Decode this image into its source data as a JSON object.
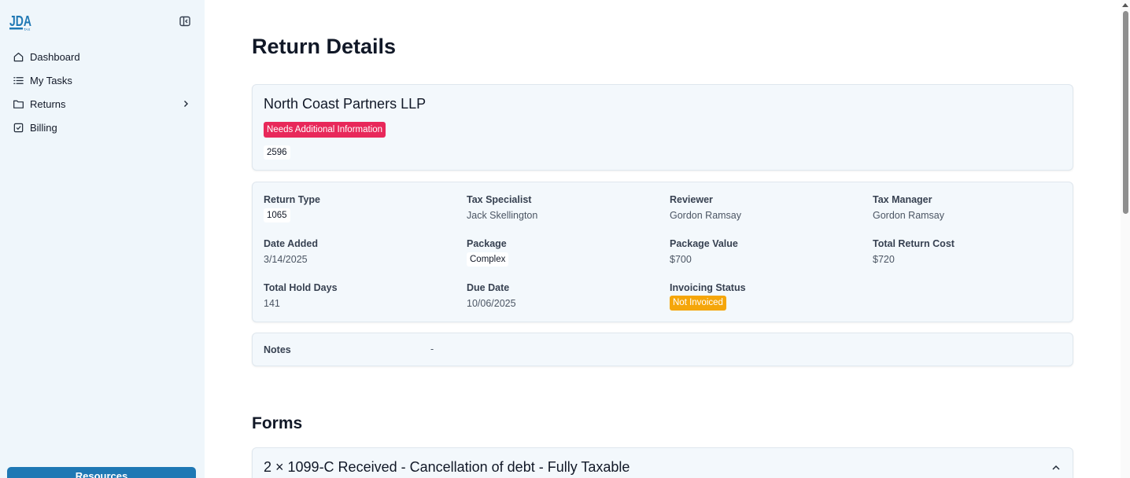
{
  "sidebar": {
    "logo": {
      "main": "JDA",
      "sub": "TAX",
      "icon": "jda-logo"
    },
    "collapse_icon": "sidebar-collapse-icon",
    "items": [
      {
        "label": "Dashboard",
        "icon": "home-icon"
      },
      {
        "label": "My Tasks",
        "icon": "list-icon"
      },
      {
        "label": "Returns",
        "icon": "folder-icon",
        "has_submenu": true
      },
      {
        "label": "Billing",
        "icon": "clipboard-check-icon"
      }
    ],
    "resources_label": "Resources"
  },
  "page": {
    "title": "Return Details"
  },
  "client": {
    "name": "North Coast Partners LLP",
    "status": "Needs Additional Information",
    "id": "2596"
  },
  "details": {
    "return_type": {
      "label": "Return Type",
      "value": "1065"
    },
    "tax_specialist": {
      "label": "Tax Specialist",
      "value": "Jack Skellington"
    },
    "reviewer": {
      "label": "Reviewer",
      "value": "Gordon Ramsay"
    },
    "tax_manager": {
      "label": "Tax Manager",
      "value": "Gordon Ramsay"
    },
    "date_added": {
      "label": "Date Added",
      "value": "3/14/2025"
    },
    "package": {
      "label": "Package",
      "value": "Complex"
    },
    "package_value": {
      "label": "Package Value",
      "value": "$700"
    },
    "total_return_cost": {
      "label": "Total Return Cost",
      "value": "$720"
    },
    "total_hold_days": {
      "label": "Total Hold Days",
      "value": "141"
    },
    "due_date": {
      "label": "Due Date",
      "value": "10/06/2025"
    },
    "invoicing_status": {
      "label": "Invoicing Status",
      "value": "Not Invoiced"
    }
  },
  "notes": {
    "label": "Notes",
    "value": "-"
  },
  "forms": {
    "title": "Forms",
    "items": [
      {
        "title": "2 × 1099-C Received - Cancellation of debt - Fully Taxable",
        "expanded": true
      }
    ]
  },
  "colors": {
    "sidebar_bg": "#eff6fb",
    "card_bg": "#f3f8fc",
    "status_badge": "#e8285a",
    "invoice_badge": "#f5a60a",
    "primary": "#1f78b4"
  }
}
